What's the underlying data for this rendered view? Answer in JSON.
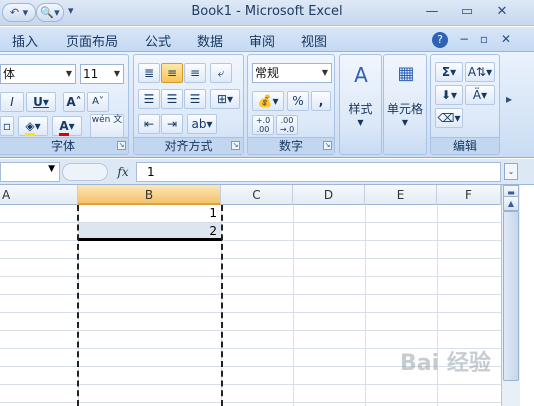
{
  "window": {
    "title": "Book1 - Microsoft Excel"
  },
  "quick_access": {
    "undo_icon": "undo-icon",
    "print_icon": "print-preview-icon",
    "customize_icon": "dropdown-arrow-icon"
  },
  "tabs": [
    "插入",
    "页面布局",
    "公式",
    "数据",
    "审阅",
    "视图"
  ],
  "ribbon": {
    "font": {
      "name": "体",
      "size": "11",
      "group_label": "字体",
      "underline": "U",
      "grow": "A",
      "shrink": "A",
      "wen": "wén 文"
    },
    "align": {
      "group_label": "对齐方式"
    },
    "number": {
      "format": "常规",
      "percent": "%",
      "comma": ",",
      "inc_dec": "+.0 .00",
      "dec_dec": ".00 →.0",
      "group_label": "数字"
    },
    "styles": {
      "label": "样式"
    },
    "cells": {
      "label": "单元格"
    },
    "editing": {
      "sigma": "Σ",
      "group_label": "编辑"
    }
  },
  "formula_bar": {
    "fx": "fx",
    "value": "1"
  },
  "columns": [
    "A",
    "B",
    "C",
    "D",
    "E",
    "F"
  ],
  "cells": {
    "B1": "1",
    "B2": "2"
  },
  "watermark": {
    "text": "Bai 经验"
  }
}
